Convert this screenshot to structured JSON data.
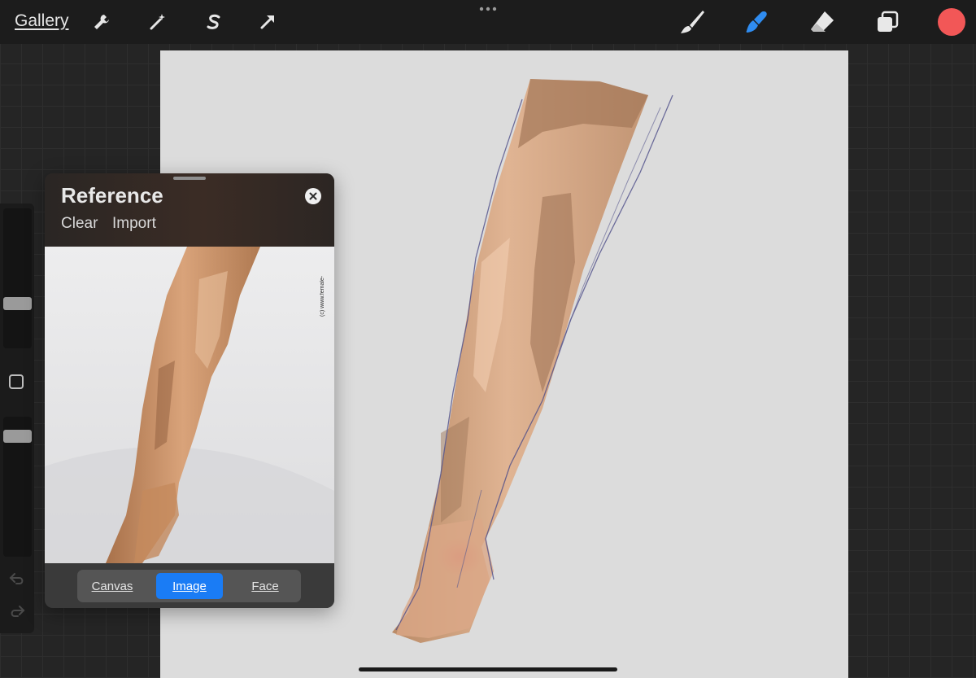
{
  "topbar": {
    "gallery_label": "Gallery",
    "left_tools": [
      "wrench-icon",
      "magic-wand-icon",
      "selection-s-icon",
      "transform-arrow-icon"
    ],
    "right_tools": [
      "brush-icon",
      "smudge-icon",
      "eraser-icon",
      "layers-icon"
    ],
    "active_tool": "smudge-icon",
    "current_color": "#f25757",
    "accent_color": "#1a7cf5"
  },
  "sidebar": {
    "brush_size_level": 0.3,
    "opacity_level": 0.9,
    "icons": [
      "modify-square-icon",
      "undo-icon",
      "redo-icon"
    ]
  },
  "reference": {
    "title": "Reference",
    "clear_label": "Clear",
    "import_label": "Import",
    "watermark": "(c) www.female-",
    "tabs": [
      "Canvas",
      "Image",
      "Face"
    ],
    "active_tab": "Image"
  }
}
